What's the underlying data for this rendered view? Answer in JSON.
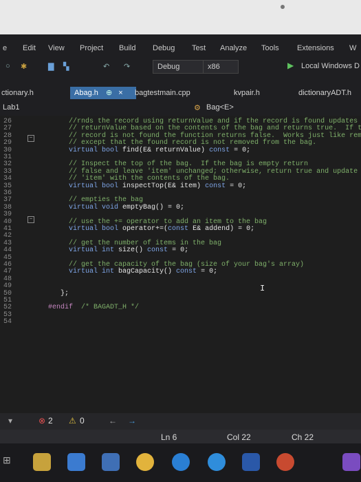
{
  "menu": [
    "e",
    "Edit",
    "View",
    "Project",
    "Build",
    "Debug",
    "Test",
    "Analyze",
    "Tools",
    "Extensions",
    "W"
  ],
  "toolbar": {
    "config": "Debug",
    "platform": "x86",
    "run_target": "Local Windows D"
  },
  "tabs": {
    "left_partial": "ctionary.h",
    "active": "Abag.h",
    "active_pin": "⊕",
    "active_close": "×",
    "items": [
      "bagtestmain.cpp",
      "kvpair.h",
      "dictionaryADT.h"
    ]
  },
  "navbar": {
    "project": "Lab1",
    "scope": "Bag<E>"
  },
  "code_lines": [
    {
      "n": "26",
      "parts": [
        {
          "t": "     //rnds the record using returnValue and if the record is found updates",
          "c": "comment"
        }
      ]
    },
    {
      "n": "27",
      "parts": [
        {
          "t": "     // returnValue based on the contents of the bag and returns true.  If the",
          "c": "comment"
        }
      ]
    },
    {
      "n": "28",
      "parts": [
        {
          "t": "     // record is not found the function returns false.  Works just like remove()",
          "c": "comment"
        }
      ]
    },
    {
      "n": "29",
      "parts": [
        {
          "t": "     // except that the found record is not removed from the bag.",
          "c": "comment"
        }
      ]
    },
    {
      "n": "30",
      "parts": [
        {
          "t": "     ",
          "c": ""
        },
        {
          "t": "virtual bool",
          "c": "kw"
        },
        {
          "t": " find(E& returnValue) ",
          "c": ""
        },
        {
          "t": "const",
          "c": "kw"
        },
        {
          "t": " = 0;",
          "c": ""
        }
      ]
    },
    {
      "n": "31",
      "parts": []
    },
    {
      "n": "32",
      "parts": [
        {
          "t": "     // Inspect the top of the bag.  If the bag is empty return",
          "c": "comment"
        }
      ]
    },
    {
      "n": "33",
      "parts": [
        {
          "t": "     // false and leave 'item' unchanged; otherwise, return true and update",
          "c": "comment"
        }
      ]
    },
    {
      "n": "34",
      "parts": [
        {
          "t": "     // 'item' with the contents of the bag.",
          "c": "comment"
        }
      ]
    },
    {
      "n": "35",
      "parts": [
        {
          "t": "     ",
          "c": ""
        },
        {
          "t": "virtual bool",
          "c": "kw"
        },
        {
          "t": " inspectTop(E& item) ",
          "c": ""
        },
        {
          "t": "const",
          "c": "kw"
        },
        {
          "t": " = 0;",
          "c": ""
        }
      ]
    },
    {
      "n": "36",
      "parts": []
    },
    {
      "n": "37",
      "parts": [
        {
          "t": "     // empties the bag",
          "c": "comment"
        }
      ]
    },
    {
      "n": "38",
      "parts": [
        {
          "t": "     ",
          "c": ""
        },
        {
          "t": "virtual void",
          "c": "kw"
        },
        {
          "t": " emptyBag() = 0;",
          "c": ""
        }
      ]
    },
    {
      "n": "39",
      "parts": []
    },
    {
      "n": "40",
      "parts": [
        {
          "t": "     // use the += operator to add an item to the bag",
          "c": "comment"
        }
      ]
    },
    {
      "n": "41",
      "parts": [
        {
          "t": "     ",
          "c": ""
        },
        {
          "t": "virtual bool",
          "c": "kw"
        },
        {
          "t": " operator+=(",
          "c": ""
        },
        {
          "t": "const",
          "c": "kw"
        },
        {
          "t": " E& addend) = 0;",
          "c": ""
        }
      ]
    },
    {
      "n": "42",
      "parts": []
    },
    {
      "n": "43",
      "parts": [
        {
          "t": "     // get the number of items in the bag",
          "c": "comment"
        }
      ]
    },
    {
      "n": "44",
      "parts": [
        {
          "t": "     ",
          "c": ""
        },
        {
          "t": "virtual int",
          "c": "kw"
        },
        {
          "t": " size() ",
          "c": ""
        },
        {
          "t": "const",
          "c": "kw"
        },
        {
          "t": " = 0;",
          "c": ""
        }
      ]
    },
    {
      "n": "45",
      "parts": []
    },
    {
      "n": "46",
      "parts": [
        {
          "t": "     // get the capacity of the bag (size of your bag's array)",
          "c": "comment"
        }
      ]
    },
    {
      "n": "47",
      "parts": [
        {
          "t": "     ",
          "c": ""
        },
        {
          "t": "virtual int",
          "c": "kw"
        },
        {
          "t": " bagCapacity() ",
          "c": ""
        },
        {
          "t": "const",
          "c": "kw"
        },
        {
          "t": " = 0;",
          "c": ""
        }
      ]
    },
    {
      "n": "48",
      "parts": []
    },
    {
      "n": "49",
      "parts": []
    },
    {
      "n": "50",
      "parts": [
        {
          "t": "   };",
          "c": ""
        }
      ]
    },
    {
      "n": "51",
      "parts": []
    },
    {
      "n": "52",
      "parts": [
        {
          "t": "#endif",
          "c": "macro"
        },
        {
          "t": "  /* BAGADT_H */",
          "c": "comment"
        }
      ]
    },
    {
      "n": "53",
      "parts": []
    },
    {
      "n": "54",
      "parts": []
    }
  ],
  "errors": {
    "error_count": "2",
    "warning_count": "0"
  },
  "status": {
    "line": "Ln 6",
    "col": "Col 22",
    "ch": "Ch 22"
  },
  "taskbar_icons": [
    "taskview-icon",
    "file-explorer-icon",
    "store-icon",
    "mail-icon",
    "chrome-icon",
    "edge-icon",
    "ie-icon",
    "word-icon",
    "powerpoint-icon",
    "visual-studio-icon"
  ],
  "colors": {
    "editor_bg": "#1e1e1e",
    "comment": "#7fb06a",
    "keyword": "#7fa6e8",
    "active_tab": "#3a6ea5"
  }
}
